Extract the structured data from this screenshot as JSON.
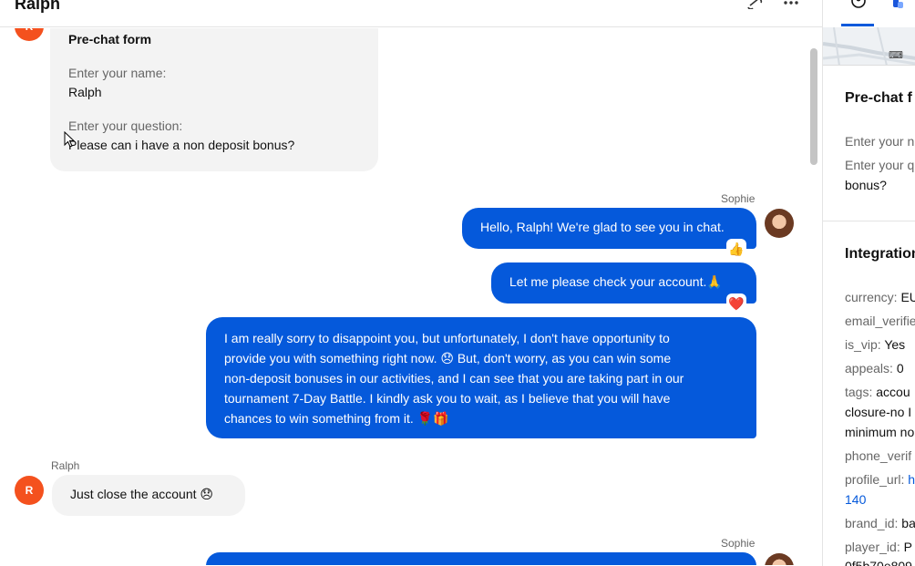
{
  "header": {
    "title": "Ralph",
    "icons": [
      "link-icon",
      "more-icon"
    ]
  },
  "chat": {
    "prechat": {
      "avatar_initial": "R",
      "title": "Pre-chat form",
      "name_label": "Enter your name:",
      "name_value": "Ralph",
      "question_label": "Enter your question:",
      "question_value": "Please can i have a non deposit bonus?"
    },
    "messages": [
      {
        "sender": "Sophie",
        "text": "Hello, Ralph! We're glad to see you in chat.",
        "reaction": "👍"
      },
      {
        "text": "Let me please check your account.🙏",
        "reaction": "❤️"
      },
      {
        "lines": [
          "I am really sorry to disappoint you, but unfortunately, I don't have opportunity to",
          "provide you with something right now. 😞 But, don't worry, as you can win some",
          "non-deposit bonuses in our activities, and I can see that you are taking part in our",
          "tournament 7-Day Battle. I kindly ask you to wait, as I believe that you will have",
          "chances to win something from it. 🌹🎁"
        ]
      },
      {
        "sender": "Ralph",
        "avatar_initial": "R",
        "text": "Just close the account 😞"
      },
      {
        "sender": "Sophie"
      }
    ]
  },
  "panel": {
    "tabs": [
      "user-circle-icon",
      "integration-icon"
    ],
    "map_keyboard_label": "⌨",
    "prechat_title": "Pre-chat f",
    "prechat_rows": [
      "Enter your n",
      "Enter your q",
      "bonus?"
    ],
    "integration_title": "Integration",
    "fields": [
      {
        "key": "currency:",
        "value": "EU"
      },
      {
        "key": "email_verifie",
        "value": ""
      },
      {
        "key": "is_vip:",
        "value": "Yes"
      },
      {
        "key": "appeals:",
        "value": "0"
      },
      {
        "key": "tags:",
        "value": "accou"
      },
      {
        "key": "",
        "value": "closure-no I"
      },
      {
        "key": "",
        "value": "minimum no"
      },
      {
        "key": "phone_verif",
        "value": ""
      },
      {
        "key": "profile_url:",
        "value": "h",
        "link": true
      },
      {
        "key": "",
        "value": "140",
        "link": true
      },
      {
        "key": "brand_id:",
        "value": "ba"
      },
      {
        "key": "player_id:",
        "value": "P"
      },
      {
        "key": "",
        "value": "0f5b70e809"
      }
    ]
  },
  "colors": {
    "accent": "#0559db",
    "avatar_user": "#f4511e",
    "bubble_in": "#f3f3f3"
  }
}
